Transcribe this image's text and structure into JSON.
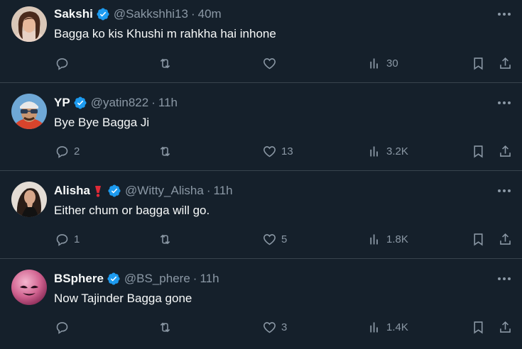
{
  "tweets": [
    {
      "name": "Sakshi",
      "emoji": "",
      "handle": "@Sakkshhi13",
      "time": "40m",
      "text": "Bagga ko kis Khushi m rahkha hai inhone",
      "replies": "",
      "reposts": "",
      "likes": "",
      "views": "30"
    },
    {
      "name": "YP",
      "emoji": "",
      "handle": "@yatin822",
      "time": "11h",
      "text": "Bye Bye Bagga Ji",
      "replies": "2",
      "reposts": "",
      "likes": "13",
      "views": "3.2K"
    },
    {
      "name": "Alisha",
      "emoji": "❗",
      "handle": "@Witty_Alisha",
      "time": "11h",
      "text": "Either chum or bagga will go.",
      "replies": "1",
      "reposts": "",
      "likes": "5",
      "views": "1.8K"
    },
    {
      "name": "BSphere",
      "emoji": "",
      "handle": "@BS_phere",
      "time": "11h",
      "text": "Now Tajinder Bagga gone",
      "replies": "",
      "reposts": "",
      "likes": "3",
      "views": "1.4K"
    }
  ],
  "separator": "·",
  "colors": {
    "background": "#15202b",
    "text": "#f7f9f9",
    "muted": "#8b98a5",
    "verified": "#1d9bf0",
    "divider": "#38444d"
  },
  "icons": [
    "verified-badge-icon",
    "more-icon",
    "reply-icon",
    "repost-icon",
    "like-icon",
    "views-icon",
    "bookmark-icon",
    "share-icon"
  ]
}
